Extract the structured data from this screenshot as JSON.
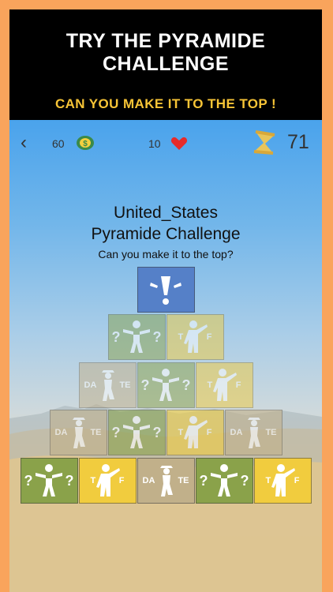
{
  "promo": {
    "title_line1": "TRY THE PYRAMIDE",
    "title_line2": "CHALLENGE",
    "subtitle": "CAN YOU MAKE IT TO THE TOP !"
  },
  "topbar": {
    "back_symbol": "‹",
    "coins": "60",
    "lives": "10",
    "timer": "71"
  },
  "challenge": {
    "country": "United_States",
    "name": "Pyramide Challenge",
    "prompt": "Can you make it to the top?"
  },
  "pyramid": {
    "rows": [
      [
        {
          "type": "top"
        }
      ],
      [
        {
          "type": "figure"
        },
        {
          "type": "truefalse"
        }
      ],
      [
        {
          "type": "date"
        },
        {
          "type": "figure"
        },
        {
          "type": "truefalse"
        }
      ],
      [
        {
          "type": "date"
        },
        {
          "type": "figure"
        },
        {
          "type": "truefalse"
        },
        {
          "type": "date"
        }
      ],
      [
        {
          "type": "figure"
        },
        {
          "type": "truefalse"
        },
        {
          "type": "date"
        },
        {
          "type": "figure"
        },
        {
          "type": "truefalse"
        }
      ]
    ],
    "labels": {
      "q": "?",
      "t": "T",
      "f": "F",
      "da": "DA",
      "te": "TE"
    }
  },
  "colors": {
    "background": "#f9a45c",
    "promo_subtitle": "#f7c436",
    "top_block": "#5580c8",
    "green": "#8aa24a",
    "yellow": "#f1cc3e",
    "tan": "#c1b08a"
  }
}
